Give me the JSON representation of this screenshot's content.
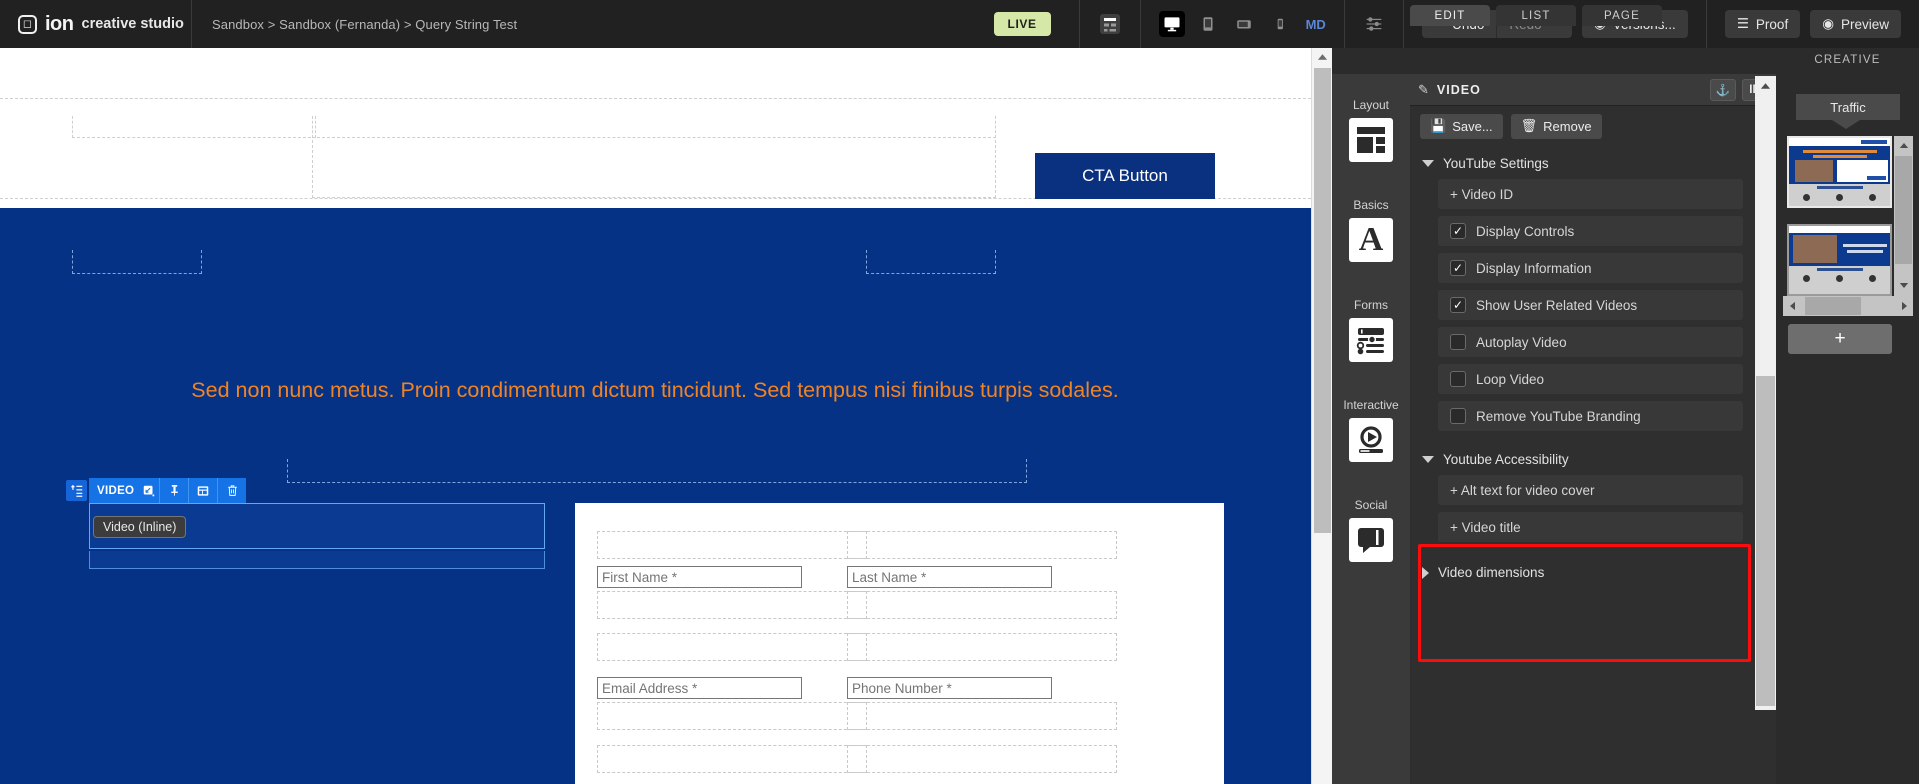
{
  "topbar": {
    "brand_name": "ion",
    "brand_suffix": "creative studio",
    "breadcrumb": "Sandbox > Sandbox (Fernanda) > Query String Test",
    "live_badge": "LIVE",
    "device_md_label": "MD",
    "undo_label": "Undo",
    "redo_label": "Redo",
    "versions_label": "Versions...",
    "proof_label": "Proof",
    "preview_label": "Preview"
  },
  "canvas": {
    "cta_button": "CTA Button",
    "headline": "Sed non nunc metus. Proin condimentum dictum tincidunt. Sed tempus nisi finibus turpis sodales.",
    "video_toolbar_label": "VIDEO",
    "video_tooltip": "Video (Inline)",
    "form_fields": [
      {
        "placeholder": "First Name *"
      },
      {
        "placeholder": "Last Name *"
      },
      {
        "placeholder": "Email Address *"
      },
      {
        "placeholder": "Phone Number *"
      }
    ],
    "colors": {
      "background_blue": "#053284",
      "headline_orange": "#f08326",
      "cta_navy": "#0a3180",
      "selection_blue": "#1673e6"
    }
  },
  "right_panel": {
    "tabs": [
      {
        "label": "EDIT",
        "active": true
      },
      {
        "label": "LIST",
        "active": false
      },
      {
        "label": "PAGE",
        "active": false
      }
    ],
    "creative_tab": "CREATIVE",
    "palette": [
      {
        "label": "Layout",
        "icon": "layout-icon"
      },
      {
        "label": "Basics",
        "icon": "letter-a-icon"
      },
      {
        "label": "Forms",
        "icon": "form-controls-icon"
      },
      {
        "label": "Interactive",
        "icon": "video-play-icon"
      },
      {
        "label": "Social",
        "icon": "speech-bubble-icon"
      }
    ],
    "pane": {
      "title": "VIDEO",
      "anchor_label": "anchor-icon",
      "id_label": "ID",
      "save_label": "Save...",
      "remove_label": "Remove",
      "sections": [
        {
          "name": "youtube-settings",
          "title": "YouTube Settings",
          "expanded": true,
          "highlighted": false,
          "rows": [
            {
              "label": "+ Video ID",
              "type": "add"
            },
            {
              "label": "Display Controls",
              "type": "checkbox",
              "checked": true
            },
            {
              "label": "Display Information",
              "type": "checkbox",
              "checked": true
            },
            {
              "label": "Show User Related Videos",
              "type": "checkbox",
              "checked": true
            },
            {
              "label": "Autoplay Video",
              "type": "checkbox",
              "checked": false
            },
            {
              "label": "Loop Video",
              "type": "checkbox",
              "checked": false
            },
            {
              "label": "Remove YouTube Branding",
              "type": "checkbox",
              "checked": false
            }
          ]
        },
        {
          "name": "youtube-accessibility",
          "title": "Youtube Accessibility",
          "expanded": true,
          "highlighted": true,
          "highlight_color": "#fb0d0d",
          "rows": [
            {
              "label": "+ Alt text for video cover",
              "type": "add"
            },
            {
              "label": "+ Video title",
              "type": "add"
            }
          ]
        },
        {
          "name": "video-dimensions",
          "title": "Video dimensions",
          "expanded": false,
          "highlighted": false,
          "rows": []
        }
      ]
    },
    "creative": {
      "traffic_label": "Traffic",
      "add_page_label": "+",
      "thumbnails": [
        {
          "name": "page-thumbnail-1",
          "selected": true
        },
        {
          "name": "page-thumbnail-2",
          "selected": false
        }
      ]
    }
  }
}
